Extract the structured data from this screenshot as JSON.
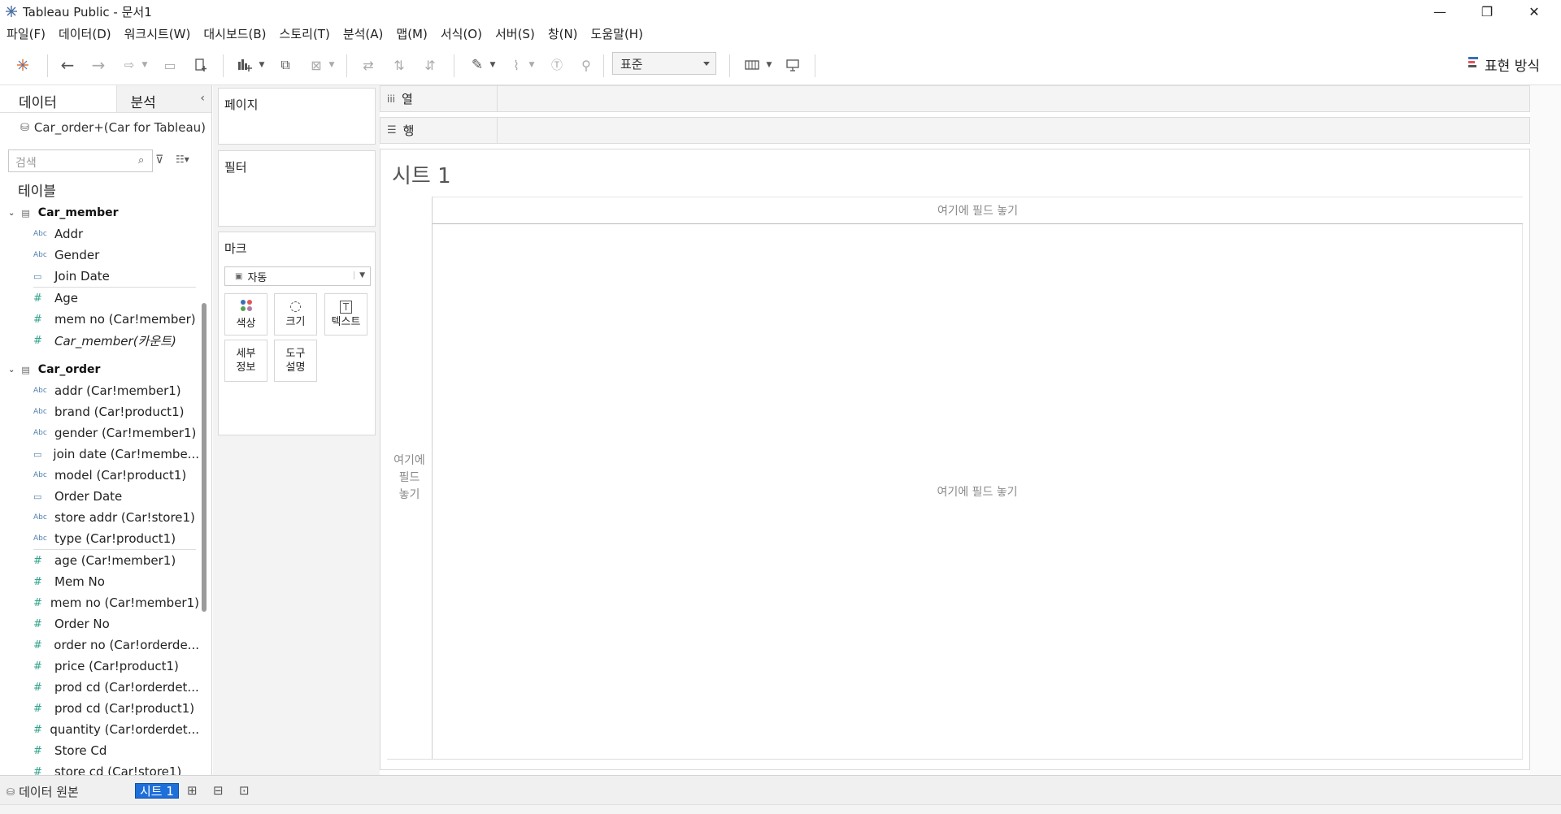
{
  "window": {
    "title": "Tableau Public - 문서1",
    "controls": {
      "minimize": "—",
      "restore": "❐",
      "close": "✕"
    }
  },
  "menu": [
    "파일(F)",
    "데이터(D)",
    "워크시트(W)",
    "대시보드(B)",
    "스토리(T)",
    "분석(A)",
    "맵(M)",
    "서식(O)",
    "서버(S)",
    "창(N)",
    "도움말(H)"
  ],
  "toolbar": {
    "fit_select": "표준",
    "show_me_label": "표현 방식"
  },
  "left_panel": {
    "tab_data": "데이터",
    "tab_analytics": "분석",
    "datasource": "Car_order+(Car for Tableau)",
    "search_placeholder": "검색",
    "tables_label": "테이블",
    "tables": [
      {
        "name": "Car_member",
        "dimensions": [
          {
            "type": "Abc",
            "name": "Addr"
          },
          {
            "type": "Abc",
            "name": "Gender"
          },
          {
            "type": "date",
            "name": "Join Date"
          }
        ],
        "measures": [
          {
            "type": "#",
            "name": "Age"
          },
          {
            "type": "#",
            "name": "mem no (Car!member)"
          },
          {
            "type": "#",
            "name": "Car_member(카운트)"
          }
        ]
      },
      {
        "name": "Car_order",
        "dimensions": [
          {
            "type": "Abc",
            "name": "addr (Car!member1)"
          },
          {
            "type": "Abc",
            "name": "brand (Car!product1)"
          },
          {
            "type": "Abc",
            "name": "gender (Car!member1)"
          },
          {
            "type": "date",
            "name": "join date (Car!membe..."
          },
          {
            "type": "Abc",
            "name": "model (Car!product1)"
          },
          {
            "type": "date",
            "name": "Order Date"
          },
          {
            "type": "Abc",
            "name": "store addr (Car!store1)"
          },
          {
            "type": "Abc",
            "name": "type (Car!product1)"
          }
        ],
        "measures": [
          {
            "type": "#",
            "name": "age (Car!member1)"
          },
          {
            "type": "#",
            "name": "Mem No"
          },
          {
            "type": "#",
            "name": "mem no (Car!member1)"
          },
          {
            "type": "#",
            "name": "Order No"
          },
          {
            "type": "#",
            "name": "order no (Car!orderde..."
          },
          {
            "type": "#",
            "name": "price (Car!product1)"
          },
          {
            "type": "#",
            "name": "prod cd (Car!orderdet..."
          },
          {
            "type": "#",
            "name": "prod cd (Car!product1)"
          },
          {
            "type": "#",
            "name": "quantity (Car!orderdet..."
          },
          {
            "type": "#",
            "name": "Store Cd"
          },
          {
            "type": "#",
            "name": "store cd (Car!store1)"
          }
        ]
      }
    ]
  },
  "shelves": {
    "pages": "페이지",
    "filters": "필터",
    "marks": "마크",
    "mark_type": "자동",
    "mark_color": "색상",
    "mark_size": "크기",
    "mark_text": "텍스트",
    "mark_detail_1": "세부",
    "mark_detail_2": "정보",
    "mark_tooltip_1": "도구",
    "mark_tooltip_2": "설명",
    "columns": "열",
    "rows": "행"
  },
  "view": {
    "sheet_title": "시트 1",
    "drop_top": "여기에 필드 놓기",
    "drop_left_1": "여기에",
    "drop_left_2": "필드",
    "drop_left_3": "놓기",
    "drop_main": "여기에 필드 놓기"
  },
  "statusbar": {
    "datasource_tab": "데이터 원본",
    "sheet_tab": "시트 1"
  },
  "colors": {
    "dimension_icon": "#4f7fae",
    "measure_icon": "#2ea28a",
    "selected_tab": "#1e6fd9"
  }
}
